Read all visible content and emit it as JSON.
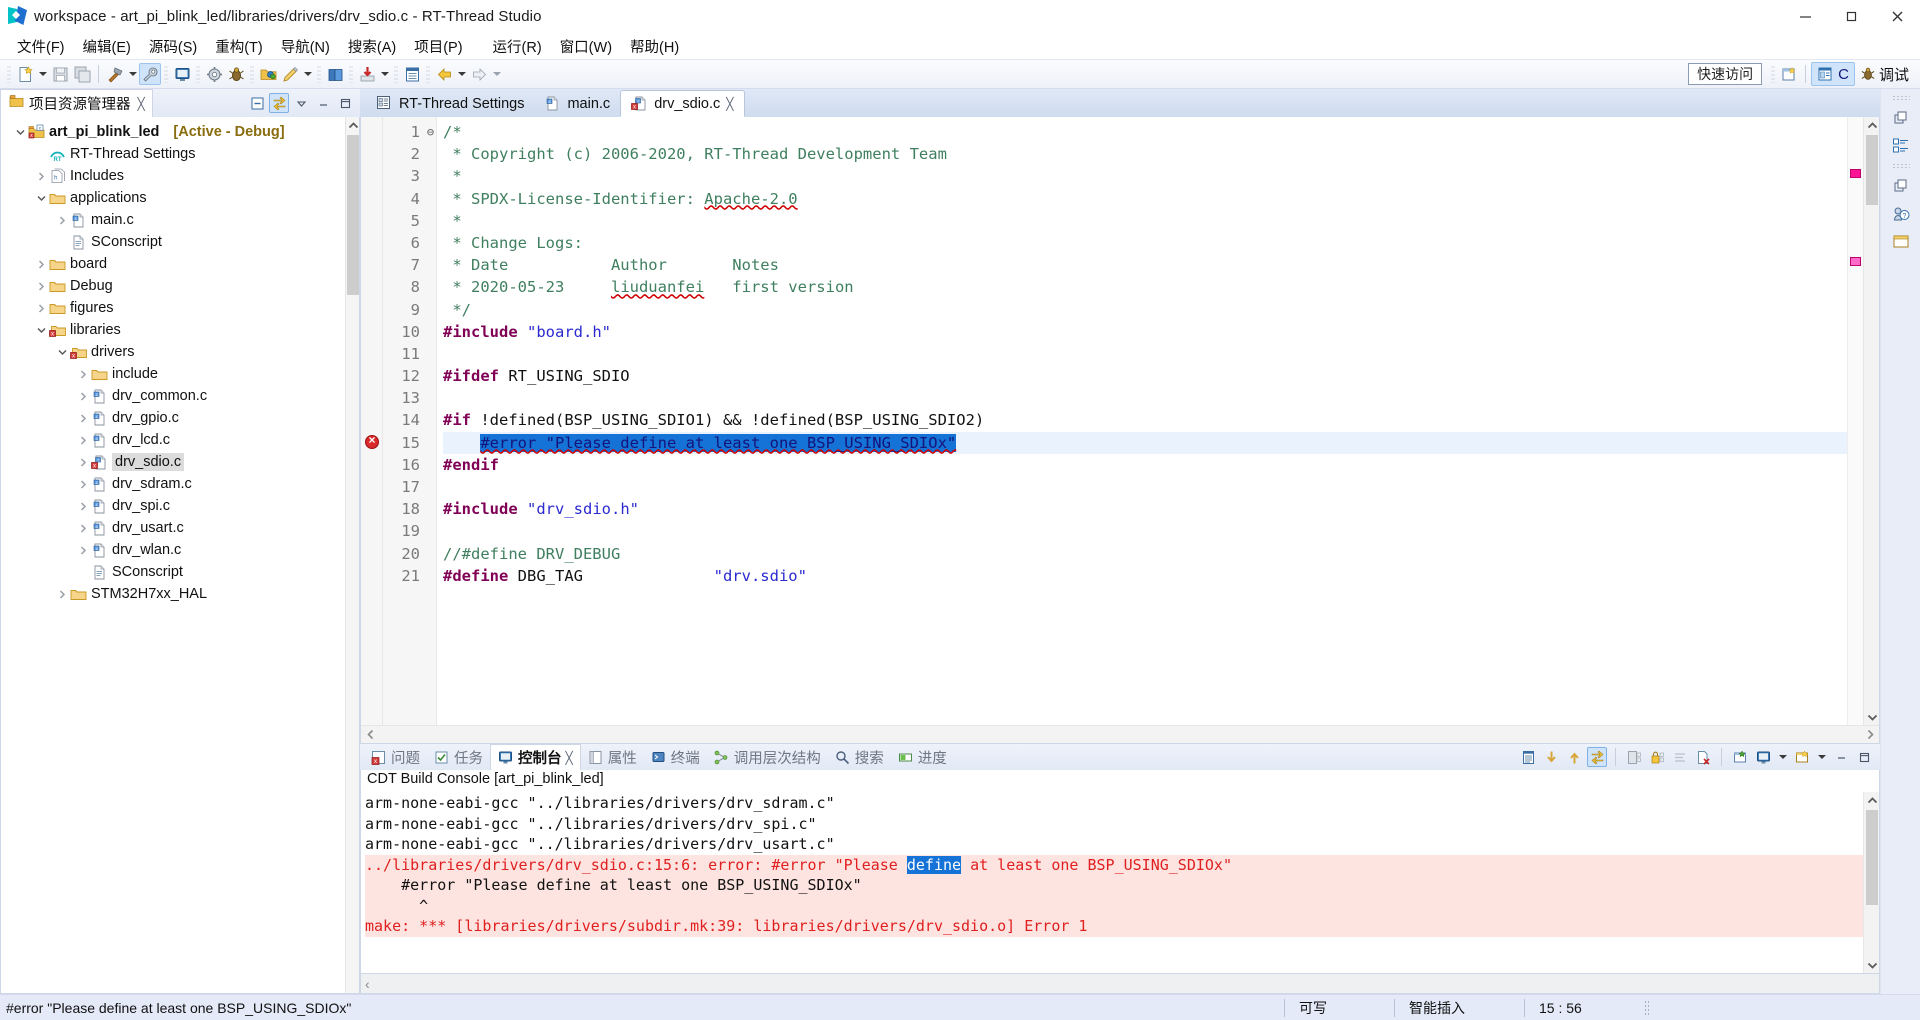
{
  "window": {
    "title": "workspace - art_pi_blink_led/libraries/drivers/drv_sdio.c - RT-Thread Studio",
    "minimize": "─",
    "maximize": "❐",
    "close": "✕"
  },
  "menubar": {
    "items": [
      "文件(F)",
      "编辑(E)",
      "源码(S)",
      "重构(T)",
      "导航(N)",
      "搜索(A)",
      "项目(P)",
      "运行(R)",
      "窗口(W)",
      "帮助(H)"
    ]
  },
  "toolbar": {
    "quick_access": "快速访问",
    "perspective_c": "C",
    "perspective_debug": "调试"
  },
  "explorer": {
    "tab_label": "项目资源管理器",
    "tab_close": "╳",
    "tree": [
      {
        "depth": 0,
        "twisty": "down",
        "icon": "c-project-icon",
        "label": "art_pi_blink_led",
        "bold": true,
        "suffix": "[Active - Debug]"
      },
      {
        "depth": 1,
        "twisty": "none",
        "icon": "rtthread-settings-icon",
        "label": "RT-Thread Settings",
        "bold": false,
        "suffix": ""
      },
      {
        "depth": 1,
        "twisty": "right",
        "icon": "includes-icon",
        "label": "Includes",
        "bold": false,
        "suffix": ""
      },
      {
        "depth": 1,
        "twisty": "down",
        "icon": "folder-icon",
        "label": "applications",
        "bold": false,
        "suffix": ""
      },
      {
        "depth": 2,
        "twisty": "right",
        "icon": "c-file-icon",
        "label": "main.c",
        "bold": false,
        "suffix": ""
      },
      {
        "depth": 2,
        "twisty": "none",
        "icon": "script-file-icon",
        "label": "SConscript",
        "bold": false,
        "suffix": ""
      },
      {
        "depth": 1,
        "twisty": "right",
        "icon": "folder-icon",
        "label": "board",
        "bold": false,
        "suffix": ""
      },
      {
        "depth": 1,
        "twisty": "right",
        "icon": "folder-icon",
        "label": "Debug",
        "bold": false,
        "suffix": ""
      },
      {
        "depth": 1,
        "twisty": "right",
        "icon": "folder-icon",
        "label": "figures",
        "bold": false,
        "suffix": ""
      },
      {
        "depth": 1,
        "twisty": "down",
        "icon": "folder-error-icon",
        "label": "libraries",
        "bold": false,
        "suffix": ""
      },
      {
        "depth": 2,
        "twisty": "down",
        "icon": "folder-error-icon",
        "label": "drivers",
        "bold": false,
        "suffix": ""
      },
      {
        "depth": 3,
        "twisty": "right",
        "icon": "folder-icon",
        "label": "include",
        "bold": false,
        "suffix": ""
      },
      {
        "depth": 3,
        "twisty": "right",
        "icon": "c-file-icon",
        "label": "drv_common.c",
        "bold": false,
        "suffix": ""
      },
      {
        "depth": 3,
        "twisty": "right",
        "icon": "c-file-icon",
        "label": "drv_gpio.c",
        "bold": false,
        "suffix": ""
      },
      {
        "depth": 3,
        "twisty": "right",
        "icon": "c-file-icon",
        "label": "drv_lcd.c",
        "bold": false,
        "suffix": ""
      },
      {
        "depth": 3,
        "twisty": "right",
        "icon": "c-file-error-icon",
        "label": "drv_sdio.c",
        "bold": false,
        "suffix": "",
        "selected": true
      },
      {
        "depth": 3,
        "twisty": "right",
        "icon": "c-file-icon",
        "label": "drv_sdram.c",
        "bold": false,
        "suffix": ""
      },
      {
        "depth": 3,
        "twisty": "right",
        "icon": "c-file-icon",
        "label": "drv_spi.c",
        "bold": false,
        "suffix": ""
      },
      {
        "depth": 3,
        "twisty": "right",
        "icon": "c-file-icon",
        "label": "drv_usart.c",
        "bold": false,
        "suffix": ""
      },
      {
        "depth": 3,
        "twisty": "right",
        "icon": "c-file-icon",
        "label": "drv_wlan.c",
        "bold": false,
        "suffix": ""
      },
      {
        "depth": 3,
        "twisty": "none",
        "icon": "script-file-icon",
        "label": "SConscript",
        "bold": false,
        "suffix": ""
      },
      {
        "depth": 2,
        "twisty": "right",
        "icon": "folder-icon",
        "label": "STM32H7xx_HAL",
        "bold": false,
        "suffix": ""
      }
    ]
  },
  "editor": {
    "tabs": [
      {
        "label": "RT-Thread Settings",
        "icon": "settings-form-icon",
        "active": false,
        "closable": false
      },
      {
        "label": "main.c",
        "icon": "c-file-icon",
        "active": false,
        "closable": false
      },
      {
        "label": "drv_sdio.c",
        "icon": "c-file-error-icon",
        "active": true,
        "closable": true,
        "close": "╳"
      }
    ],
    "lines": [
      {
        "n": "1",
        "fold": "⊖",
        "segs": [
          {
            "t": "/*",
            "c": "cmt"
          }
        ]
      },
      {
        "n": "2",
        "fold": "",
        "segs": [
          {
            "t": " * Copyright (c) 2006-2020, RT-Thread Development Team",
            "c": "cmt"
          }
        ]
      },
      {
        "n": "3",
        "fold": "",
        "segs": [
          {
            "t": " *",
            "c": "cmt"
          }
        ]
      },
      {
        "n": "4",
        "fold": "",
        "segs": [
          {
            "t": " * SPDX-License-Identifier: ",
            "c": "cmt"
          },
          {
            "t": "Apache-2.0",
            "c": "cmt squiggle"
          }
        ]
      },
      {
        "n": "5",
        "fold": "",
        "segs": [
          {
            "t": " *",
            "c": "cmt"
          }
        ]
      },
      {
        "n": "6",
        "fold": "",
        "segs": [
          {
            "t": " * Change Logs:",
            "c": "cmt"
          }
        ]
      },
      {
        "n": "7",
        "fold": "",
        "segs": [
          {
            "t": " * Date           Author       Notes",
            "c": "cmt"
          }
        ]
      },
      {
        "n": "8",
        "fold": "",
        "segs": [
          {
            "t": " * 2020-05-23     ",
            "c": "cmt"
          },
          {
            "t": "liuduanfei",
            "c": "cmt squiggle"
          },
          {
            "t": "   first version",
            "c": "cmt"
          }
        ]
      },
      {
        "n": "9",
        "fold": "",
        "segs": [
          {
            "t": " */",
            "c": "cmt"
          }
        ]
      },
      {
        "n": "10",
        "fold": "",
        "segs": [
          {
            "t": "#include ",
            "c": "pp"
          },
          {
            "t": "\"board.h\"",
            "c": "str"
          }
        ]
      },
      {
        "n": "11",
        "fold": "",
        "segs": [
          {
            "t": "",
            "c": ""
          }
        ]
      },
      {
        "n": "12",
        "fold": "",
        "segs": [
          {
            "t": "#ifdef ",
            "c": "pp"
          },
          {
            "t": "RT_USING_SDIO",
            "c": ""
          }
        ]
      },
      {
        "n": "13",
        "fold": "",
        "segs": [
          {
            "t": "",
            "c": ""
          }
        ]
      },
      {
        "n": "14",
        "fold": "",
        "segs": [
          {
            "t": "#if ",
            "c": "pp"
          },
          {
            "t": "!defined(BSP_USING_SDIO1) && !defined(BSP_USING_SDIO2)",
            "c": ""
          }
        ]
      },
      {
        "n": "15",
        "fold": "",
        "highlight": true,
        "error": true,
        "segs": [
          {
            "t": "    ",
            "c": ""
          },
          {
            "t": "#error \"Please define at least one BSP_USING_SDIOx\"",
            "c": "sel squiggle"
          }
        ]
      },
      {
        "n": "16",
        "fold": "",
        "segs": [
          {
            "t": "#endif",
            "c": "pp"
          }
        ]
      },
      {
        "n": "17",
        "fold": "",
        "segs": [
          {
            "t": "",
            "c": ""
          }
        ]
      },
      {
        "n": "18",
        "fold": "",
        "segs": [
          {
            "t": "#include ",
            "c": "pp"
          },
          {
            "t": "\"drv_sdio.h\"",
            "c": "str"
          }
        ]
      },
      {
        "n": "19",
        "fold": "",
        "segs": [
          {
            "t": "",
            "c": ""
          }
        ]
      },
      {
        "n": "20",
        "fold": "",
        "segs": [
          {
            "t": "//#define DRV_DEBUG",
            "c": "cmt"
          }
        ]
      },
      {
        "n": "21",
        "fold": "",
        "segs": [
          {
            "t": "#define ",
            "c": "pp"
          },
          {
            "t": "DBG_TAG              ",
            "c": ""
          },
          {
            "t": "\"drv.sdio\"",
            "c": "str"
          }
        ]
      }
    ]
  },
  "bottom": {
    "tabs": [
      {
        "label": "问题",
        "icon": "problems-icon",
        "active": false
      },
      {
        "label": "任务",
        "icon": "tasks-icon",
        "active": false
      },
      {
        "label": "控制台",
        "icon": "console-icon",
        "active": true,
        "close": "╳"
      },
      {
        "label": "属性",
        "icon": "properties-icon",
        "active": false
      },
      {
        "label": "终端",
        "icon": "terminal-icon",
        "active": false
      },
      {
        "label": "调用层次结构",
        "icon": "call-hierarchy-icon",
        "active": false
      },
      {
        "label": "搜索",
        "icon": "search-icon",
        "active": false
      },
      {
        "label": "进度",
        "icon": "progress-icon",
        "active": false
      }
    ],
    "console_title": "CDT Build Console [art_pi_blink_led]",
    "lines": [
      {
        "style": "plain",
        "segs": [
          {
            "t": "arm-none-eabi-gcc \"../libraries/drivers/drv_sdram.c\""
          }
        ]
      },
      {
        "style": "plain",
        "segs": [
          {
            "t": "arm-none-eabi-gcc \"../libraries/drivers/drv_spi.c\""
          }
        ]
      },
      {
        "style": "plain",
        "segs": [
          {
            "t": "arm-none-eabi-gcc \"../libraries/drivers/drv_usart.c\""
          }
        ]
      },
      {
        "style": "err",
        "segs": [
          {
            "t": "../libraries/drivers/drv_sdio.c:15:6: error: #error \"Please "
          },
          {
            "t": "define",
            "c": "cseldef"
          },
          {
            "t": " at least one BSP_USING_SDIOx\""
          }
        ]
      },
      {
        "style": "errplain",
        "segs": [
          {
            "t": "    #error \"Please define at least one BSP_USING_SDIOx\""
          }
        ]
      },
      {
        "style": "errplain",
        "segs": [
          {
            "t": "      ^"
          }
        ]
      },
      {
        "style": "err",
        "segs": [
          {
            "t": "make: *** [libraries/drivers/subdir.mk:39: libraries/drivers/drv_sdio.o] Error 1"
          }
        ]
      }
    ],
    "hscroll_arrow": "‹"
  },
  "statusbar": {
    "message": "#error \"Please define at least one BSP_USING_SDIOx\"",
    "writable": "可写",
    "insert_mode": "智能插入",
    "position": "15 : 56"
  },
  "colors": {
    "selection_blue": "#1572d6",
    "error_red": "#e02020",
    "error_bg": "#fde4e0",
    "comment_green": "#3f7f5f",
    "preproc_purple": "#7f0055",
    "string_blue": "#2a2ad0",
    "accent_gold": "#8a6d0f"
  }
}
